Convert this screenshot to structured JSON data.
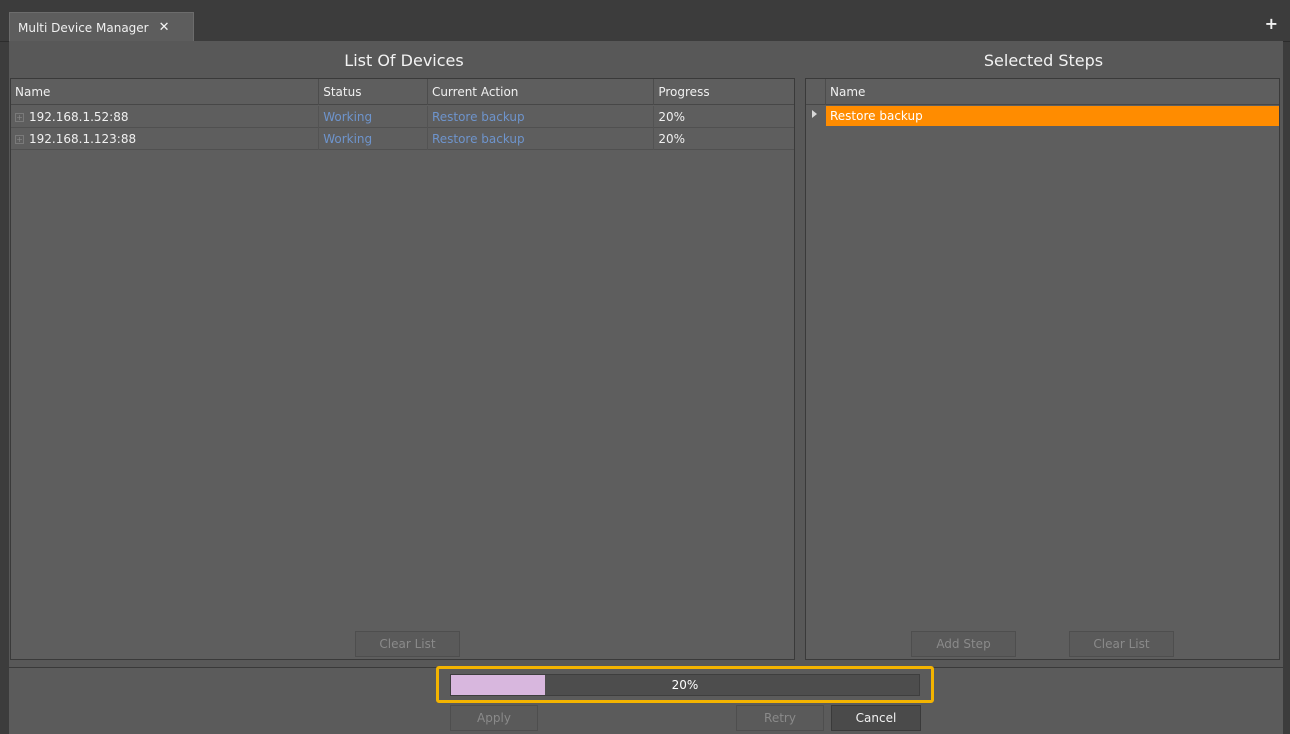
{
  "tab": {
    "title": "Multi Device Manager",
    "close_glyph": "✕",
    "add_glyph": "+"
  },
  "left_panel": {
    "title": "List Of Devices",
    "columns": [
      "Name",
      "Status",
      "Current Action",
      "Progress"
    ],
    "rows": [
      {
        "name": "192.168.1.52:88",
        "status": "Working",
        "action": "Restore backup",
        "progress": "20%"
      },
      {
        "name": "192.168.1.123:88",
        "status": "Working",
        "action": "Restore backup",
        "progress": "20%"
      }
    ],
    "clear_label": "Clear List"
  },
  "right_panel": {
    "title": "Selected Steps",
    "column": "Name",
    "steps": [
      {
        "name": "Restore backup",
        "selected": true
      }
    ],
    "add_step_label": "Add Step",
    "clear_label": "Clear List"
  },
  "footer": {
    "progress_text": "20%",
    "progress_value": 0.2,
    "apply_label": "Apply",
    "retry_label": "Retry",
    "cancel_label": "Cancel"
  },
  "colors": {
    "selected_step": "#ff8c00",
    "link_text": "#6e94cc",
    "progress_fill": "#d8b7de",
    "highlight_border": "#f4b400"
  }
}
